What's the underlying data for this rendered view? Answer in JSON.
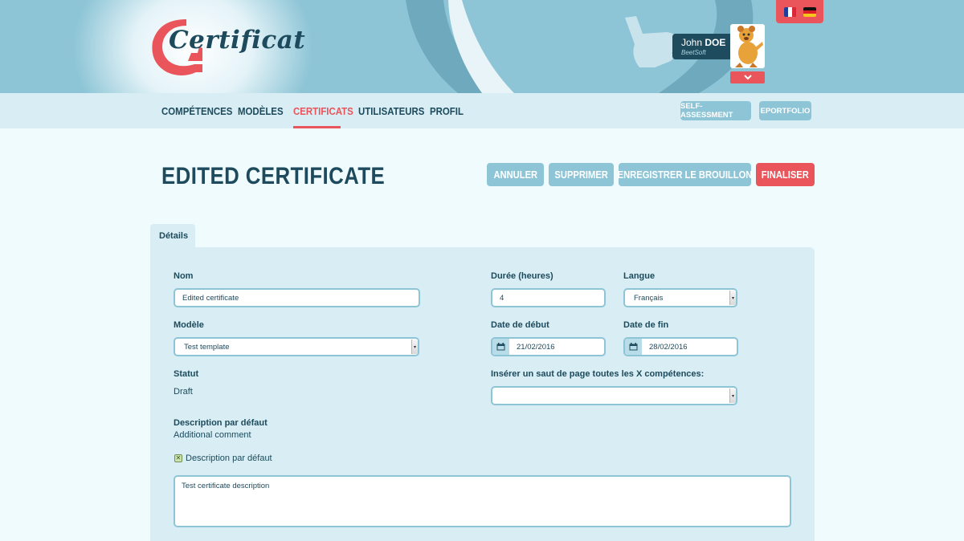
{
  "app": {
    "logo_text": "Certificat"
  },
  "languages": [
    "fr",
    "de"
  ],
  "user": {
    "first_name": "John",
    "last_name": "DOE",
    "company": "BeetSoft"
  },
  "nav": {
    "items": [
      "Compétences",
      "Modèles",
      "Certificats",
      "Utilisateurs",
      "Profil"
    ],
    "active": "Certificats",
    "right_buttons": [
      "Self-assessment",
      "ePortfolio"
    ]
  },
  "page": {
    "title": "Edited certificate",
    "actions": {
      "cancel": "Annuler",
      "delete": "Supprimer",
      "save_draft": "Enregistrer le brouillon",
      "finalize": "Finaliser"
    }
  },
  "tabs": [
    "Détails"
  ],
  "form": {
    "name": {
      "label": "Nom",
      "value": "Edited certificate"
    },
    "duration": {
      "label": "Durée (heures)",
      "value": "4"
    },
    "language": {
      "label": "Langue",
      "value": "Français"
    },
    "template": {
      "label": "Modèle",
      "value": "Test template"
    },
    "start_date": {
      "label": "Date de début",
      "value": "21/02/2016"
    },
    "end_date": {
      "label": "Date de fin",
      "value": "28/02/2016"
    },
    "status": {
      "label": "Statut",
      "value": "Draft"
    },
    "page_break": {
      "label": "Insérer un saut de page toutes les X compétences:",
      "value": ""
    },
    "default_description": {
      "label": "Description par défaut",
      "value": "Additional comment"
    },
    "use_default_checkbox": {
      "label": "Description par défaut",
      "checked": true
    },
    "description": {
      "value": "Test certificate description"
    }
  },
  "colors": {
    "accent": "#e9555b",
    "primary": "#1d4a5c",
    "secondary": "#8ec5d6"
  }
}
